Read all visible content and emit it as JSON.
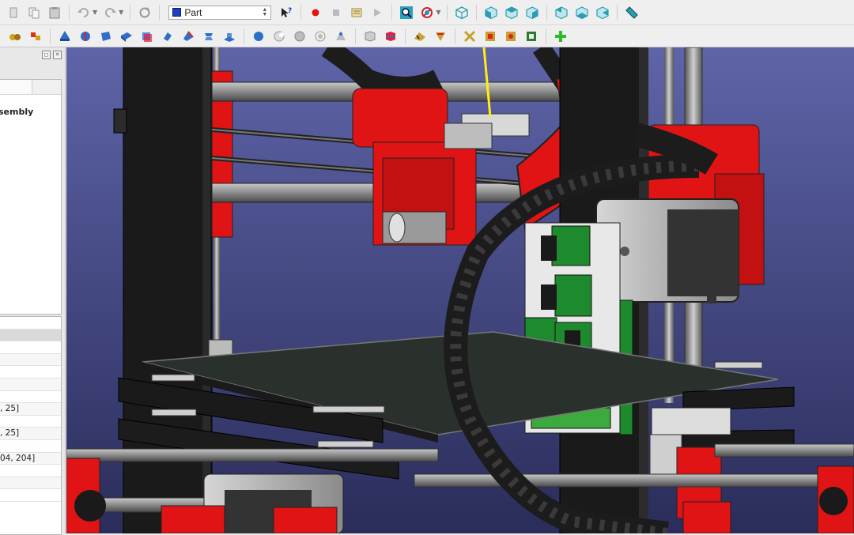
{
  "toolbar": {
    "workbench_selector": {
      "selected": "Part",
      "icon": "part-cube-icon"
    },
    "row1_icons": [
      "cut-icon",
      "copy-icon",
      "paste-icon",
      "undo-icon",
      "redo-icon",
      "refresh-icon",
      "whats-this-icon",
      "record-macro-icon",
      "stop-macro-icon",
      "edit-macro-icon",
      "run-macro-icon",
      "fit-all-icon",
      "draw-style-icon",
      "view-isometric-icon",
      "view-front-icon",
      "view-top-icon",
      "view-right-icon",
      "view-rear-icon",
      "view-bottom-icon",
      "view-left-icon",
      "measure-icon"
    ],
    "row2_icons": [
      "box-icon",
      "cylinder-icon",
      "sphere-icon",
      "cone-icon",
      "torus-icon",
      "primitives-icon",
      "shape-builder-icon",
      "extrude-icon",
      "revolve-icon",
      "mirror-icon",
      "fillet-icon",
      "chamfer-icon",
      "boolean-icon",
      "cut-icon",
      "fuse-icon",
      "common-icon",
      "section-icon",
      "cross-section-icon",
      "offset-icon",
      "thickness-icon",
      "check-geometry-icon",
      "measure-linear-icon",
      "measure-angular-icon",
      "measure-refresh-icon",
      "measure-clear-icon",
      "toggle-3d-icon",
      "add-icon"
    ]
  },
  "tree": {
    "item_label": "sembly"
  },
  "properties": {
    "rows": [
      "",
      "",
      "",
      "",
      "",
      "",
      "",
      ", 25]",
      "",
      ", 25]",
      "",
      "04, 204]",
      "",
      "",
      ""
    ]
  },
  "colors": {
    "frame_red": "#e01414",
    "frame_black": "#1a1a1a",
    "background_top": "#5e64a8",
    "background_bottom": "#2a2d5a",
    "board_green": "#1e8a2e"
  }
}
